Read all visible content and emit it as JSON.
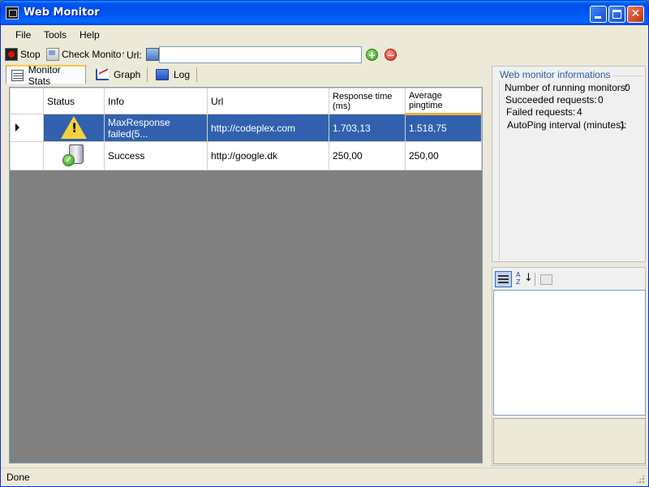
{
  "window": {
    "title": "Web Monitor"
  },
  "menu": {
    "file": "File",
    "tools": "Tools",
    "help": "Help"
  },
  "toolbar": {
    "stop_label": "Stop",
    "check_label": "Check Monitor",
    "url_label": "Url:",
    "url_value": ""
  },
  "tabs": [
    {
      "label": "Monitor Stats",
      "active": true
    },
    {
      "label": "Graph",
      "active": false
    },
    {
      "label": "Log",
      "active": false
    }
  ],
  "grid": {
    "columns": [
      "Status",
      "Info",
      "Url",
      "Response time (ms)",
      "Average pingtime"
    ],
    "rows": [
      {
        "status_icon": "warning-icon",
        "info": "MaxResponse failed(5...",
        "url": "http://codeplex.com",
        "response": "1.703,13",
        "average": "1.518,75",
        "selected": true
      },
      {
        "status_icon": "success-icon",
        "info": "Success",
        "url": "http://google.dk",
        "response": "250,00",
        "average": "250,00",
        "selected": false
      }
    ]
  },
  "info": {
    "group_title": "Web monitor informations",
    "running_label": "Number of running  monitors:",
    "running_value": "0",
    "succeeded_label": "Succeeded requests:",
    "succeeded_value": "0",
    "failed_label": "Failed requests:",
    "failed_value": "4",
    "autoping_label": "AutoPing interval (minutes):",
    "autoping_value": "1"
  },
  "status": {
    "text": "Done"
  },
  "colors": {
    "selection": "#3161ae",
    "titlebar": "#0054e3",
    "sort_accent": "#f7b23c"
  }
}
